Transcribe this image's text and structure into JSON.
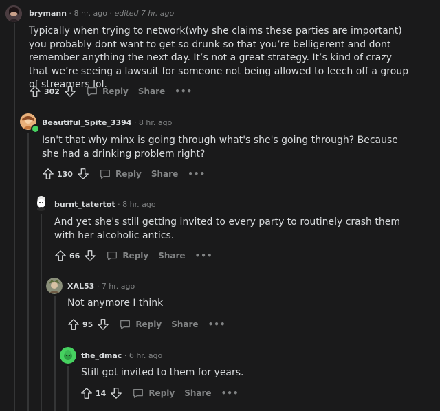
{
  "comments": [
    {
      "username": "brymann",
      "time": "8 hr. ago",
      "edited": "edited 7 hr. ago",
      "body": "Typically when trying to network(why she claims these parties are important) you probably dont want to get so drunk so that you’re belligerent and dont remember anything the next day. It’s not a great strategy. It’s kind of crazy that we’re seeing a lawsuit for someone not being allowed to leech off a group of streamers lol.",
      "score": "302",
      "reply": "Reply",
      "share": "Share",
      "more": "•••"
    },
    {
      "username": "Beautiful_Spite_3394",
      "time": "8 hr. ago",
      "body": "Isn't that why minx is going through what's she's going through? Because she had a drinking problem right?",
      "score": "130",
      "reply": "Reply",
      "share": "Share",
      "more": "•••"
    },
    {
      "username": "burnt_tatertot",
      "time": "8 hr. ago",
      "body": "And yet she's still getting invited to every party to routinely crash them with her alcoholic antics.",
      "score": "66",
      "reply": "Reply",
      "share": "Share",
      "more": "•••"
    },
    {
      "username": "XAL53",
      "time": "7 hr. ago",
      "body": "Not anymore I think",
      "score": "95",
      "reply": "Reply",
      "share": "Share",
      "more": "•••"
    },
    {
      "username": "the_dmac",
      "time": "6 hr. ago",
      "body": "Still got invited to them for years.",
      "score": "14",
      "reply": "Reply",
      "share": "Share",
      "more": "•••"
    }
  ],
  "separator": "·",
  "colors": {
    "background": "#1a1a1b",
    "text": "#d7dadc",
    "muted": "#818384",
    "thread_line": "#343536",
    "online_badge": "#46d160"
  },
  "icons": [
    "upvote-icon",
    "downvote-icon",
    "comment-bubble-icon",
    "more-options-icon"
  ]
}
